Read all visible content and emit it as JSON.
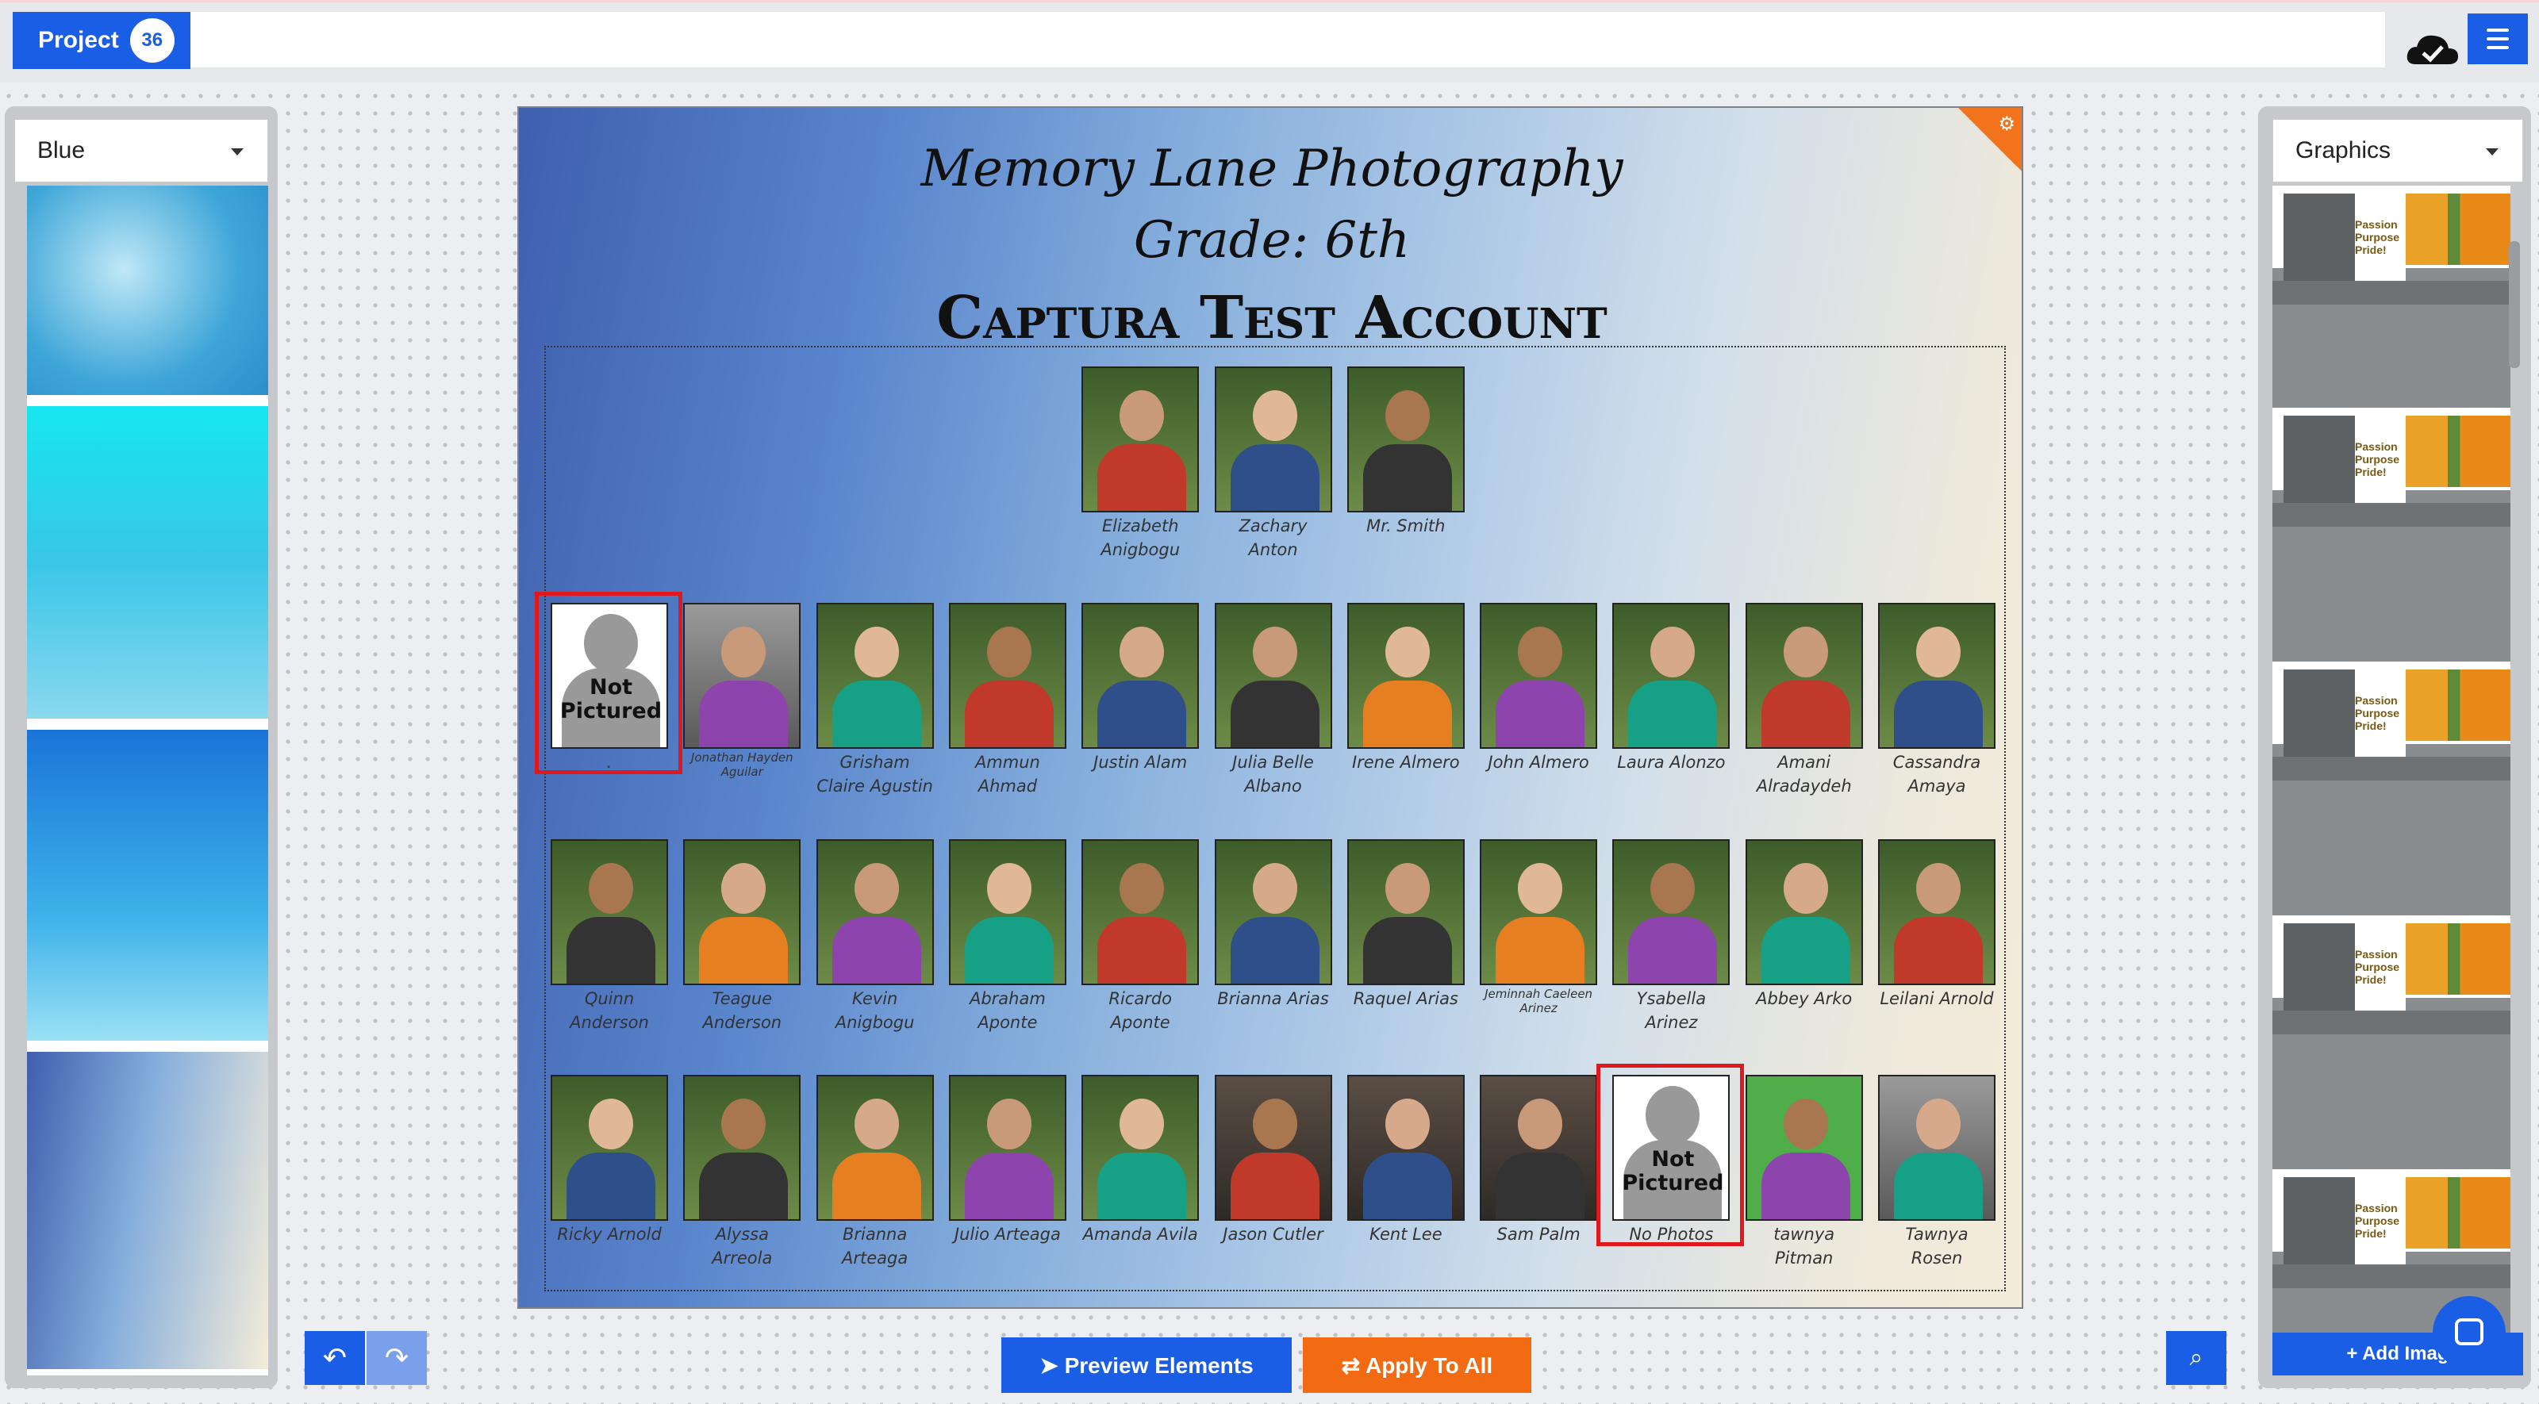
{
  "topbar": {
    "project_label": "Project",
    "project_count": "36",
    "project_name": ""
  },
  "left_panel": {
    "dropdown": "Blue"
  },
  "right_panel": {
    "dropdown": "Graphics",
    "add_image": "+ Add Imag",
    "graphic_text": "Passion Purpose Pride!"
  },
  "canvas": {
    "title": "Memory Lane Photography",
    "grade": "Grade: 6th",
    "account": "Captura Test Account",
    "not_pictured": "Not Pictured"
  },
  "people": [
    {
      "row": 0,
      "col": 4,
      "name": "Elizabeth Anigbogu",
      "photo": "green"
    },
    {
      "row": 0,
      "col": 5,
      "name": "Zachary Anton",
      "photo": "green"
    },
    {
      "row": 0,
      "col": 6,
      "name": "Mr. Smith",
      "photo": "green"
    },
    {
      "row": 1,
      "col": 0,
      "name": ".",
      "photo": "not_pictured",
      "highlight": true
    },
    {
      "row": 1,
      "col": 1,
      "name": "Jonathan Hayden Aguilar",
      "photo": "gray",
      "small": true
    },
    {
      "row": 1,
      "col": 2,
      "name": "Grisham Claire Agustin",
      "photo": "green"
    },
    {
      "row": 1,
      "col": 3,
      "name": "Ammun Ahmad",
      "photo": "green"
    },
    {
      "row": 1,
      "col": 4,
      "name": "Justin Alam",
      "photo": "green"
    },
    {
      "row": 1,
      "col": 5,
      "name": "Julia Belle Albano",
      "photo": "green"
    },
    {
      "row": 1,
      "col": 6,
      "name": "Irene Almero",
      "photo": "green"
    },
    {
      "row": 1,
      "col": 7,
      "name": "John Almero",
      "photo": "green"
    },
    {
      "row": 1,
      "col": 8,
      "name": "Laura Alonzo",
      "photo": "green"
    },
    {
      "row": 1,
      "col": 9,
      "name": "Amani Alradaydeh",
      "photo": "green"
    },
    {
      "row": 1,
      "col": 10,
      "name": "Cassandra Amaya",
      "photo": "green"
    },
    {
      "row": 2,
      "col": 0,
      "name": "Quinn Anderson",
      "photo": "green"
    },
    {
      "row": 2,
      "col": 1,
      "name": "Teague Anderson",
      "photo": "green"
    },
    {
      "row": 2,
      "col": 2,
      "name": "Kevin Anigbogu",
      "photo": "green"
    },
    {
      "row": 2,
      "col": 3,
      "name": "Abraham Aponte",
      "photo": "green"
    },
    {
      "row": 2,
      "col": 4,
      "name": "Ricardo Aponte",
      "photo": "green"
    },
    {
      "row": 2,
      "col": 5,
      "name": "Brianna Arias",
      "photo": "green"
    },
    {
      "row": 2,
      "col": 6,
      "name": "Raquel Arias",
      "photo": "green"
    },
    {
      "row": 2,
      "col": 7,
      "name": "Jeminnah Caeleen Arinez",
      "photo": "green",
      "small": true
    },
    {
      "row": 2,
      "col": 8,
      "name": "Ysabella Arinez",
      "photo": "green"
    },
    {
      "row": 2,
      "col": 9,
      "name": "Abbey Arko",
      "photo": "green"
    },
    {
      "row": 2,
      "col": 10,
      "name": "Leilani Arnold",
      "photo": "green"
    },
    {
      "row": 3,
      "col": 0,
      "name": "Ricky Arnold",
      "photo": "green"
    },
    {
      "row": 3,
      "col": 1,
      "name": "Alyssa Arreola",
      "photo": "green"
    },
    {
      "row": 3,
      "col": 2,
      "name": "Brianna Arteaga",
      "photo": "green"
    },
    {
      "row": 3,
      "col": 3,
      "name": "Julio Arteaga",
      "photo": "green"
    },
    {
      "row": 3,
      "col": 4,
      "name": "Amanda Avila",
      "photo": "green"
    },
    {
      "row": 3,
      "col": 5,
      "name": "Jason Cutler",
      "photo": "studio"
    },
    {
      "row": 3,
      "col": 6,
      "name": "Kent Lee",
      "photo": "studio"
    },
    {
      "row": 3,
      "col": 7,
      "name": "Sam Palm",
      "photo": "studio"
    },
    {
      "row": 3,
      "col": 8,
      "name": "No Photos",
      "photo": "not_pictured",
      "highlight": true
    },
    {
      "row": 3,
      "col": 9,
      "name": "tawnya Pitman",
      "photo": "lime"
    },
    {
      "row": 3,
      "col": 10,
      "name": "Tawnya Rosen",
      "photo": "gray"
    }
  ],
  "toolbar": {
    "preview": "Preview Elements",
    "apply": "Apply To All"
  }
}
